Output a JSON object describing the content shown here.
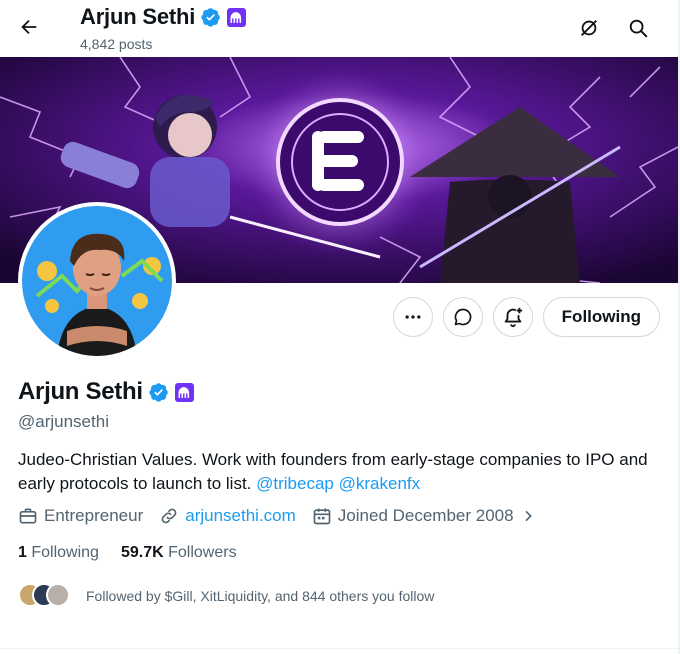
{
  "header": {
    "name": "Arjun Sethi",
    "posts": "4,842 posts"
  },
  "profile": {
    "display_name": "Arjun Sethi",
    "handle": "@arjunsethi",
    "bio_text": "Judeo-Christian Values. Work with founders from early-stage companies to IPO and early protocols to launch to list.",
    "bio_mentions": [
      "@tribecap",
      "@krakenfx"
    ],
    "occupation": "Entrepreneur",
    "website": "arjunsethi.com",
    "joined": "Joined December 2008",
    "following_count": "1",
    "following_label": "Following",
    "followers_count": "59.7K",
    "followers_label": "Followers",
    "followed_by": "Followed by $Gill, XitLiquidity, and 844 others you follow"
  },
  "actions": {
    "following_button": "Following"
  },
  "icons": {
    "back": "arrow-left-icon",
    "grok": "grok-icon",
    "search": "search-icon",
    "more": "more-icon",
    "message": "message-icon",
    "notify": "bell-plus-icon",
    "verified": "verified-badge-icon",
    "org": "kraken-org-badge-icon",
    "briefcase": "briefcase-icon",
    "link": "link-icon",
    "calendar": "calendar-icon",
    "chevron": "chevron-right-icon"
  },
  "colors": {
    "verified_blue": "#1d9bf0",
    "org_purple": "#7132f5",
    "link_blue": "#1d9bf0",
    "banner_purple": "#3a0a6b"
  }
}
